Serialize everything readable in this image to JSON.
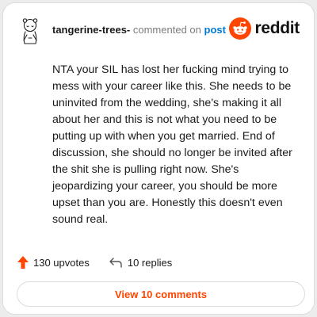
{
  "header": {
    "username": "tangerine-trees-",
    "action_text": "commented on",
    "post_link": "post",
    "brand_name": "reddit"
  },
  "comment": {
    "text": "NTA your SIL has lost her fucking mind trying to mess with your career like this. She needs to be uninvited from the wedding, she's making it all about her and this is not what you need to be putting up with when you get married. End of discussion, she should no longer be invited after the shit she is pulling right now. She's jeopardizing your career, you should be more upset than you are. Honestly this doesn't even sound real."
  },
  "actions": {
    "upvotes": "130 upvotes",
    "replies": "10 replies"
  },
  "footer": {
    "view_comments": "View 10 comments"
  },
  "colors": {
    "brand": "#ff4500",
    "link": "#0079d3",
    "text": "#1a1a1b"
  }
}
